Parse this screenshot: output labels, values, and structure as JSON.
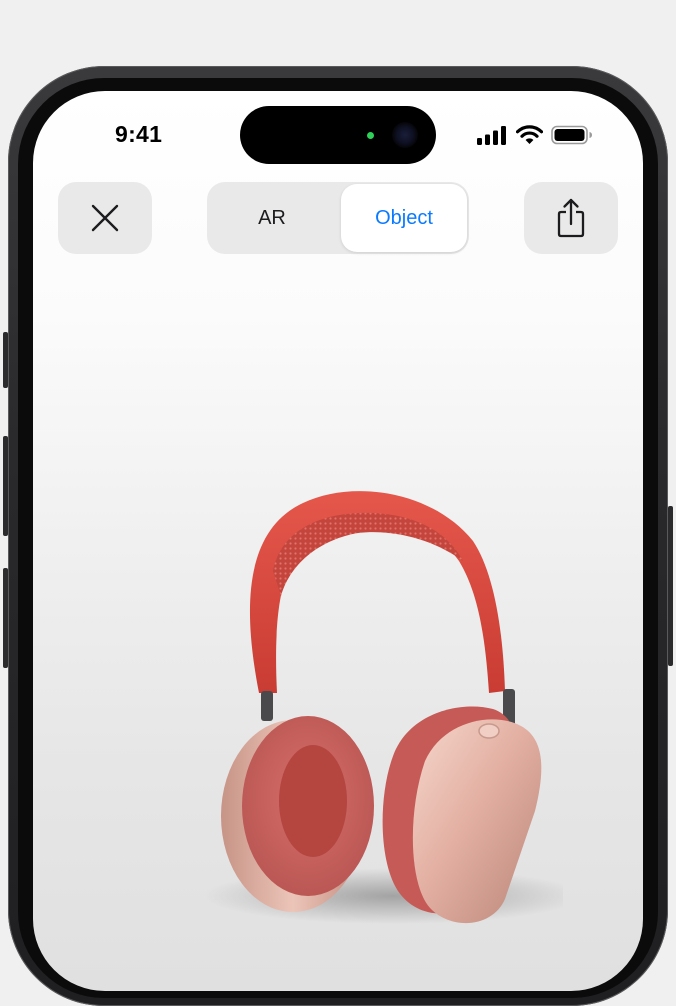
{
  "status_bar": {
    "time": "9:41",
    "icons": [
      "cellular-signal-icon",
      "wifi-icon",
      "battery-icon"
    ]
  },
  "toolbar": {
    "close_icon": "close-icon",
    "share_icon": "share-icon",
    "segments": [
      {
        "label": "AR",
        "selected": false
      },
      {
        "label": "Object",
        "selected": true
      }
    ]
  },
  "colors": {
    "accent": "#0a7aff",
    "button_bg": "#e9e9ea",
    "headband": "#d9453b",
    "cushion": "#d0706e",
    "cup": "#e4b3a6"
  },
  "viewer": {
    "object": "headphones-3d-model"
  }
}
